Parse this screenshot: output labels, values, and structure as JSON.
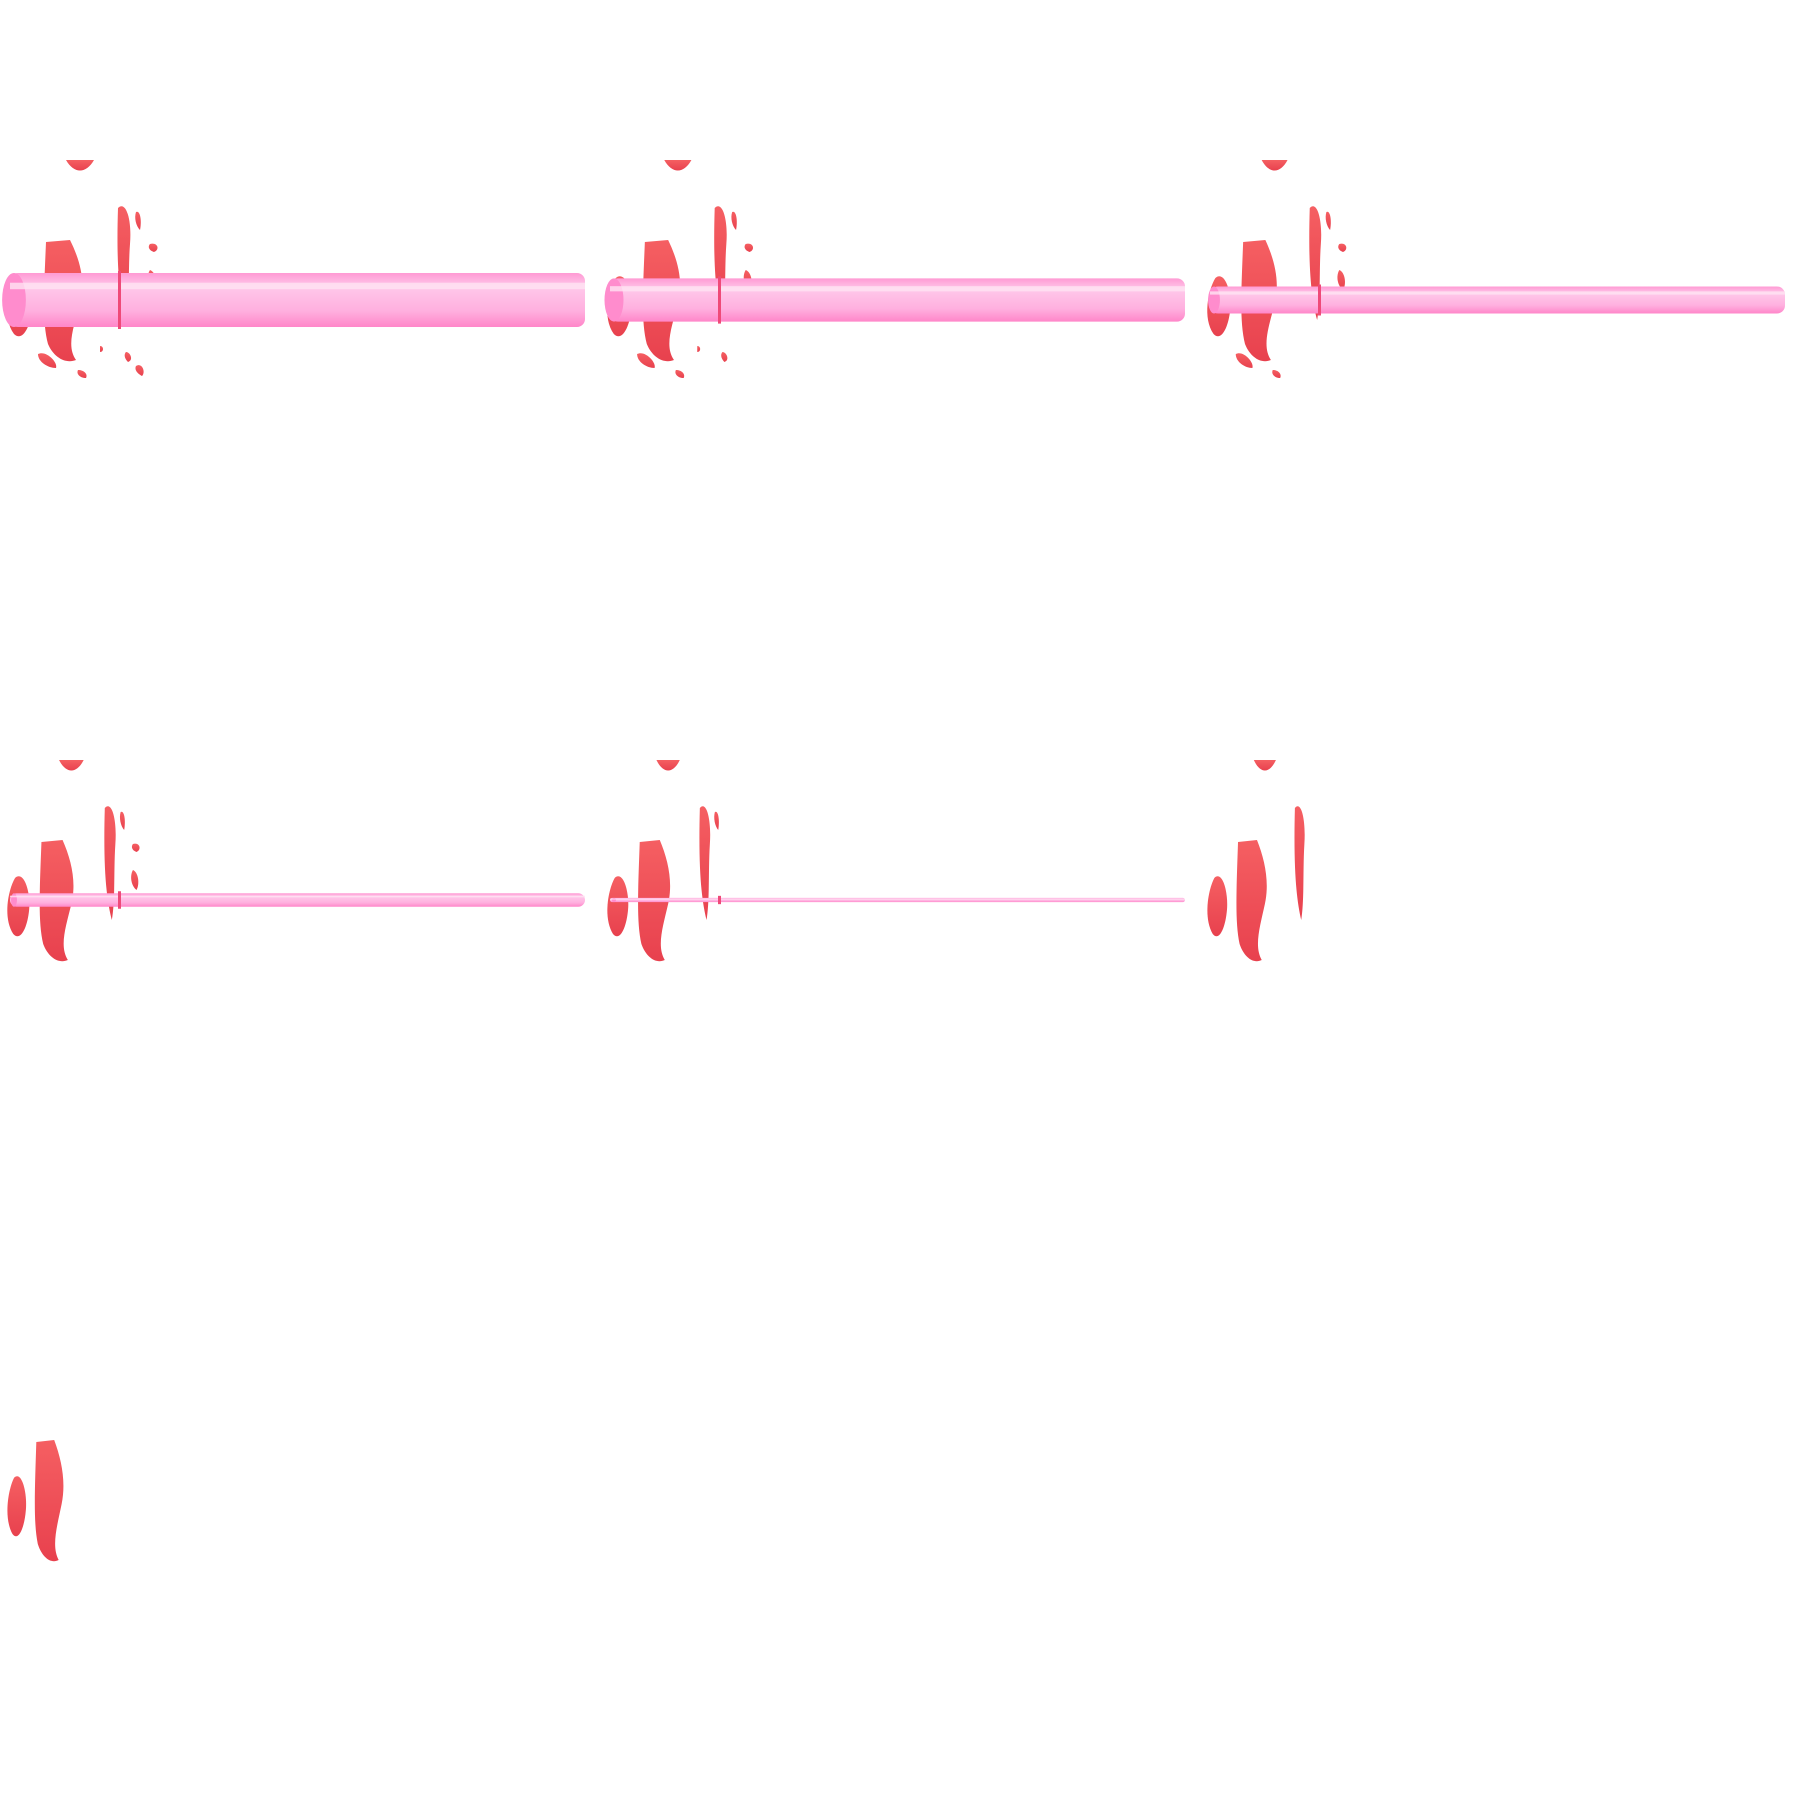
{
  "sheet": {
    "frames": [
      {
        "index": 1,
        "flame_level": 1.0,
        "beam_thickness": 1.0,
        "beam_visible": true
      },
      {
        "index": 2,
        "flame_level": 0.9,
        "beam_thickness": 0.8,
        "beam_visible": true
      },
      {
        "index": 3,
        "flame_level": 0.75,
        "beam_thickness": 0.5,
        "beam_visible": true
      },
      {
        "index": 4,
        "flame_level": 0.6,
        "beam_thickness": 0.25,
        "beam_visible": true
      },
      {
        "index": 5,
        "flame_level": 0.45,
        "beam_thickness": 0.08,
        "beam_visible": true
      },
      {
        "index": 6,
        "flame_level": 0.3,
        "beam_thickness": 0,
        "beam_visible": false
      },
      {
        "index": 7,
        "flame_level": 0.15,
        "beam_thickness": 0,
        "beam_visible": false
      }
    ],
    "colors": {
      "beam_light": "#ffc8ea",
      "beam_mid": "#ffb0df",
      "beam_dark": "#ff8ccd",
      "flame_light": "#f76a6a",
      "flame_dark": "#e83a4a"
    },
    "icons": [
      "flame-burst-icon",
      "laser-beam-icon"
    ]
  }
}
